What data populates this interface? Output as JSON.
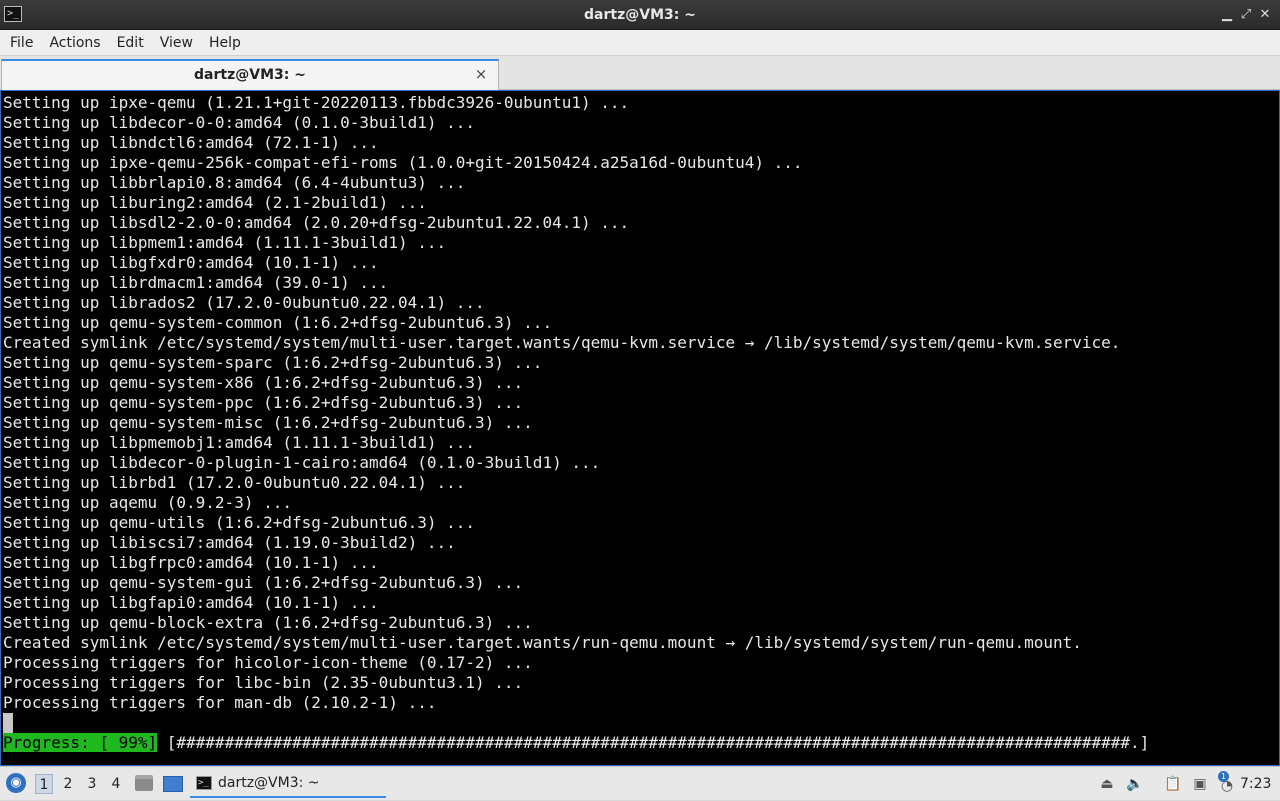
{
  "window": {
    "title": "dartz@VM3: ~",
    "app_icon": "terminal-icon",
    "controls": [
      "minimize",
      "maximize",
      "close"
    ]
  },
  "menubar": {
    "items": [
      "File",
      "Actions",
      "Edit",
      "View",
      "Help"
    ]
  },
  "tabs": [
    {
      "label": "dartz@VM3: ~",
      "close": "×"
    }
  ],
  "terminal": {
    "lines": [
      "Setting up ipxe-qemu (1.21.1+git-20220113.fbbdc3926-0ubuntu1) ...",
      "Setting up libdecor-0-0:amd64 (0.1.0-3build1) ...",
      "Setting up libndctl6:amd64 (72.1-1) ...",
      "Setting up ipxe-qemu-256k-compat-efi-roms (1.0.0+git-20150424.a25a16d-0ubuntu4) ...",
      "Setting up libbrlapi0.8:amd64 (6.4-4ubuntu3) ...",
      "Setting up liburing2:amd64 (2.1-2build1) ...",
      "Setting up libsdl2-2.0-0:amd64 (2.0.20+dfsg-2ubuntu1.22.04.1) ...",
      "Setting up libpmem1:amd64 (1.11.1-3build1) ...",
      "Setting up libgfxdr0:amd64 (10.1-1) ...",
      "Setting up librdmacm1:amd64 (39.0-1) ...",
      "Setting up librados2 (17.2.0-0ubuntu0.22.04.1) ...",
      "Setting up qemu-system-common (1:6.2+dfsg-2ubuntu6.3) ...",
      "Created symlink /etc/systemd/system/multi-user.target.wants/qemu-kvm.service → /lib/systemd/system/qemu-kvm.service.",
      "Setting up qemu-system-sparc (1:6.2+dfsg-2ubuntu6.3) ...",
      "Setting up qemu-system-x86 (1:6.2+dfsg-2ubuntu6.3) ...",
      "Setting up qemu-system-ppc (1:6.2+dfsg-2ubuntu6.3) ...",
      "Setting up qemu-system-misc (1:6.2+dfsg-2ubuntu6.3) ...",
      "Setting up libpmemobj1:amd64 (1.11.1-3build1) ...",
      "Setting up libdecor-0-plugin-1-cairo:amd64 (0.1.0-3build1) ...",
      "Setting up librbd1 (17.2.0-0ubuntu0.22.04.1) ...",
      "Setting up aqemu (0.9.2-3) ...",
      "Setting up qemu-utils (1:6.2+dfsg-2ubuntu6.3) ...",
      "Setting up libiscsi7:amd64 (1.19.0-3build2) ...",
      "Setting up libgfrpc0:amd64 (10.1-1) ...",
      "Setting up qemu-system-gui (1:6.2+dfsg-2ubuntu6.3) ...",
      "Setting up libgfapi0:amd64 (10.1-1) ...",
      "Setting up qemu-block-extra (1:6.2+dfsg-2ubuntu6.3) ...",
      "Created symlink /etc/systemd/system/multi-user.target.wants/run-qemu.mount → /lib/systemd/system/run-qemu.mount.",
      "Processing triggers for hicolor-icon-theme (0.17-2) ...",
      "Processing triggers for libc-bin (2.35-0ubuntu3.1) ...",
      "Processing triggers for man-db (2.10.2-1) ..."
    ],
    "progress": {
      "label": "Progress: [ 99%]",
      "bar": "[###################################################################################################.]",
      "percent": 99
    },
    "colors": {
      "background": "#000000",
      "text": "#e8e8e8",
      "progress_bg": "#1fb81f"
    }
  },
  "taskbar": {
    "start_icon": "lubuntu-start-icon",
    "workspaces": [
      "1",
      "2",
      "3",
      "4"
    ],
    "active_workspace": "1",
    "quicklaunch": [
      "file-manager-icon",
      "show-desktop-icon"
    ],
    "task": {
      "label": "dartz@VM3: ~",
      "icon": "terminal-icon"
    },
    "tray": [
      "removable-drive-icon",
      "volume-icon",
      "clipboard-icon",
      "network-icon",
      "update-notifier-icon"
    ],
    "notification_badge": "1",
    "clock": "7:23"
  }
}
